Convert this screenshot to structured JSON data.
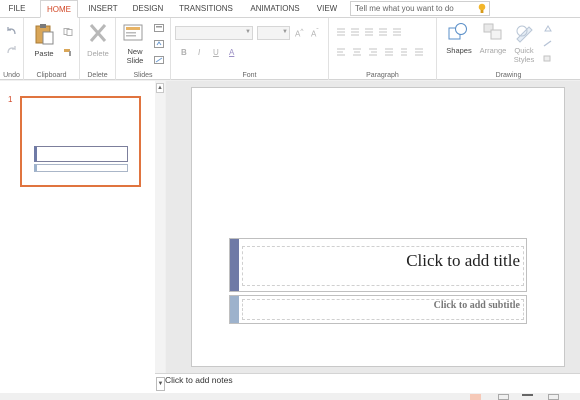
{
  "tabs": [
    "FILE",
    "HOME",
    "INSERT",
    "DESIGN",
    "TRANSITIONS",
    "ANIMATIONS",
    "VIEW"
  ],
  "active_tab": "HOME",
  "tell_me": {
    "placeholder": "Tell me what you want to do"
  },
  "ribbon": {
    "groups": {
      "undo": "Undo",
      "clipboard": "Clipboard",
      "delete": "Delete",
      "slides": "Slides",
      "font": "Font",
      "paragraph": "Paragraph",
      "drawing": "Drawing"
    },
    "buttons": {
      "paste": "Paste",
      "delete": "Delete",
      "new_slide_1": "New",
      "new_slide_2": "Slide",
      "shapes": "Shapes",
      "arrange": "Arrange",
      "quick_styles_1": "Quick",
      "quick_styles_2": "Styles"
    },
    "font_buttons": [
      "B",
      "I",
      "U",
      "A"
    ]
  },
  "thumbnails": {
    "slide_number": "1"
  },
  "slide": {
    "title_placeholder": "Click to add title",
    "subtitle_placeholder": "Click to add subtitle"
  },
  "notes": {
    "placeholder": "Click to add notes"
  },
  "colors": {
    "accent": "#d24726",
    "title_bar": "#6f7aa6",
    "subtitle_bar": "#9db2cc",
    "thumb_border": "#e0743f"
  }
}
